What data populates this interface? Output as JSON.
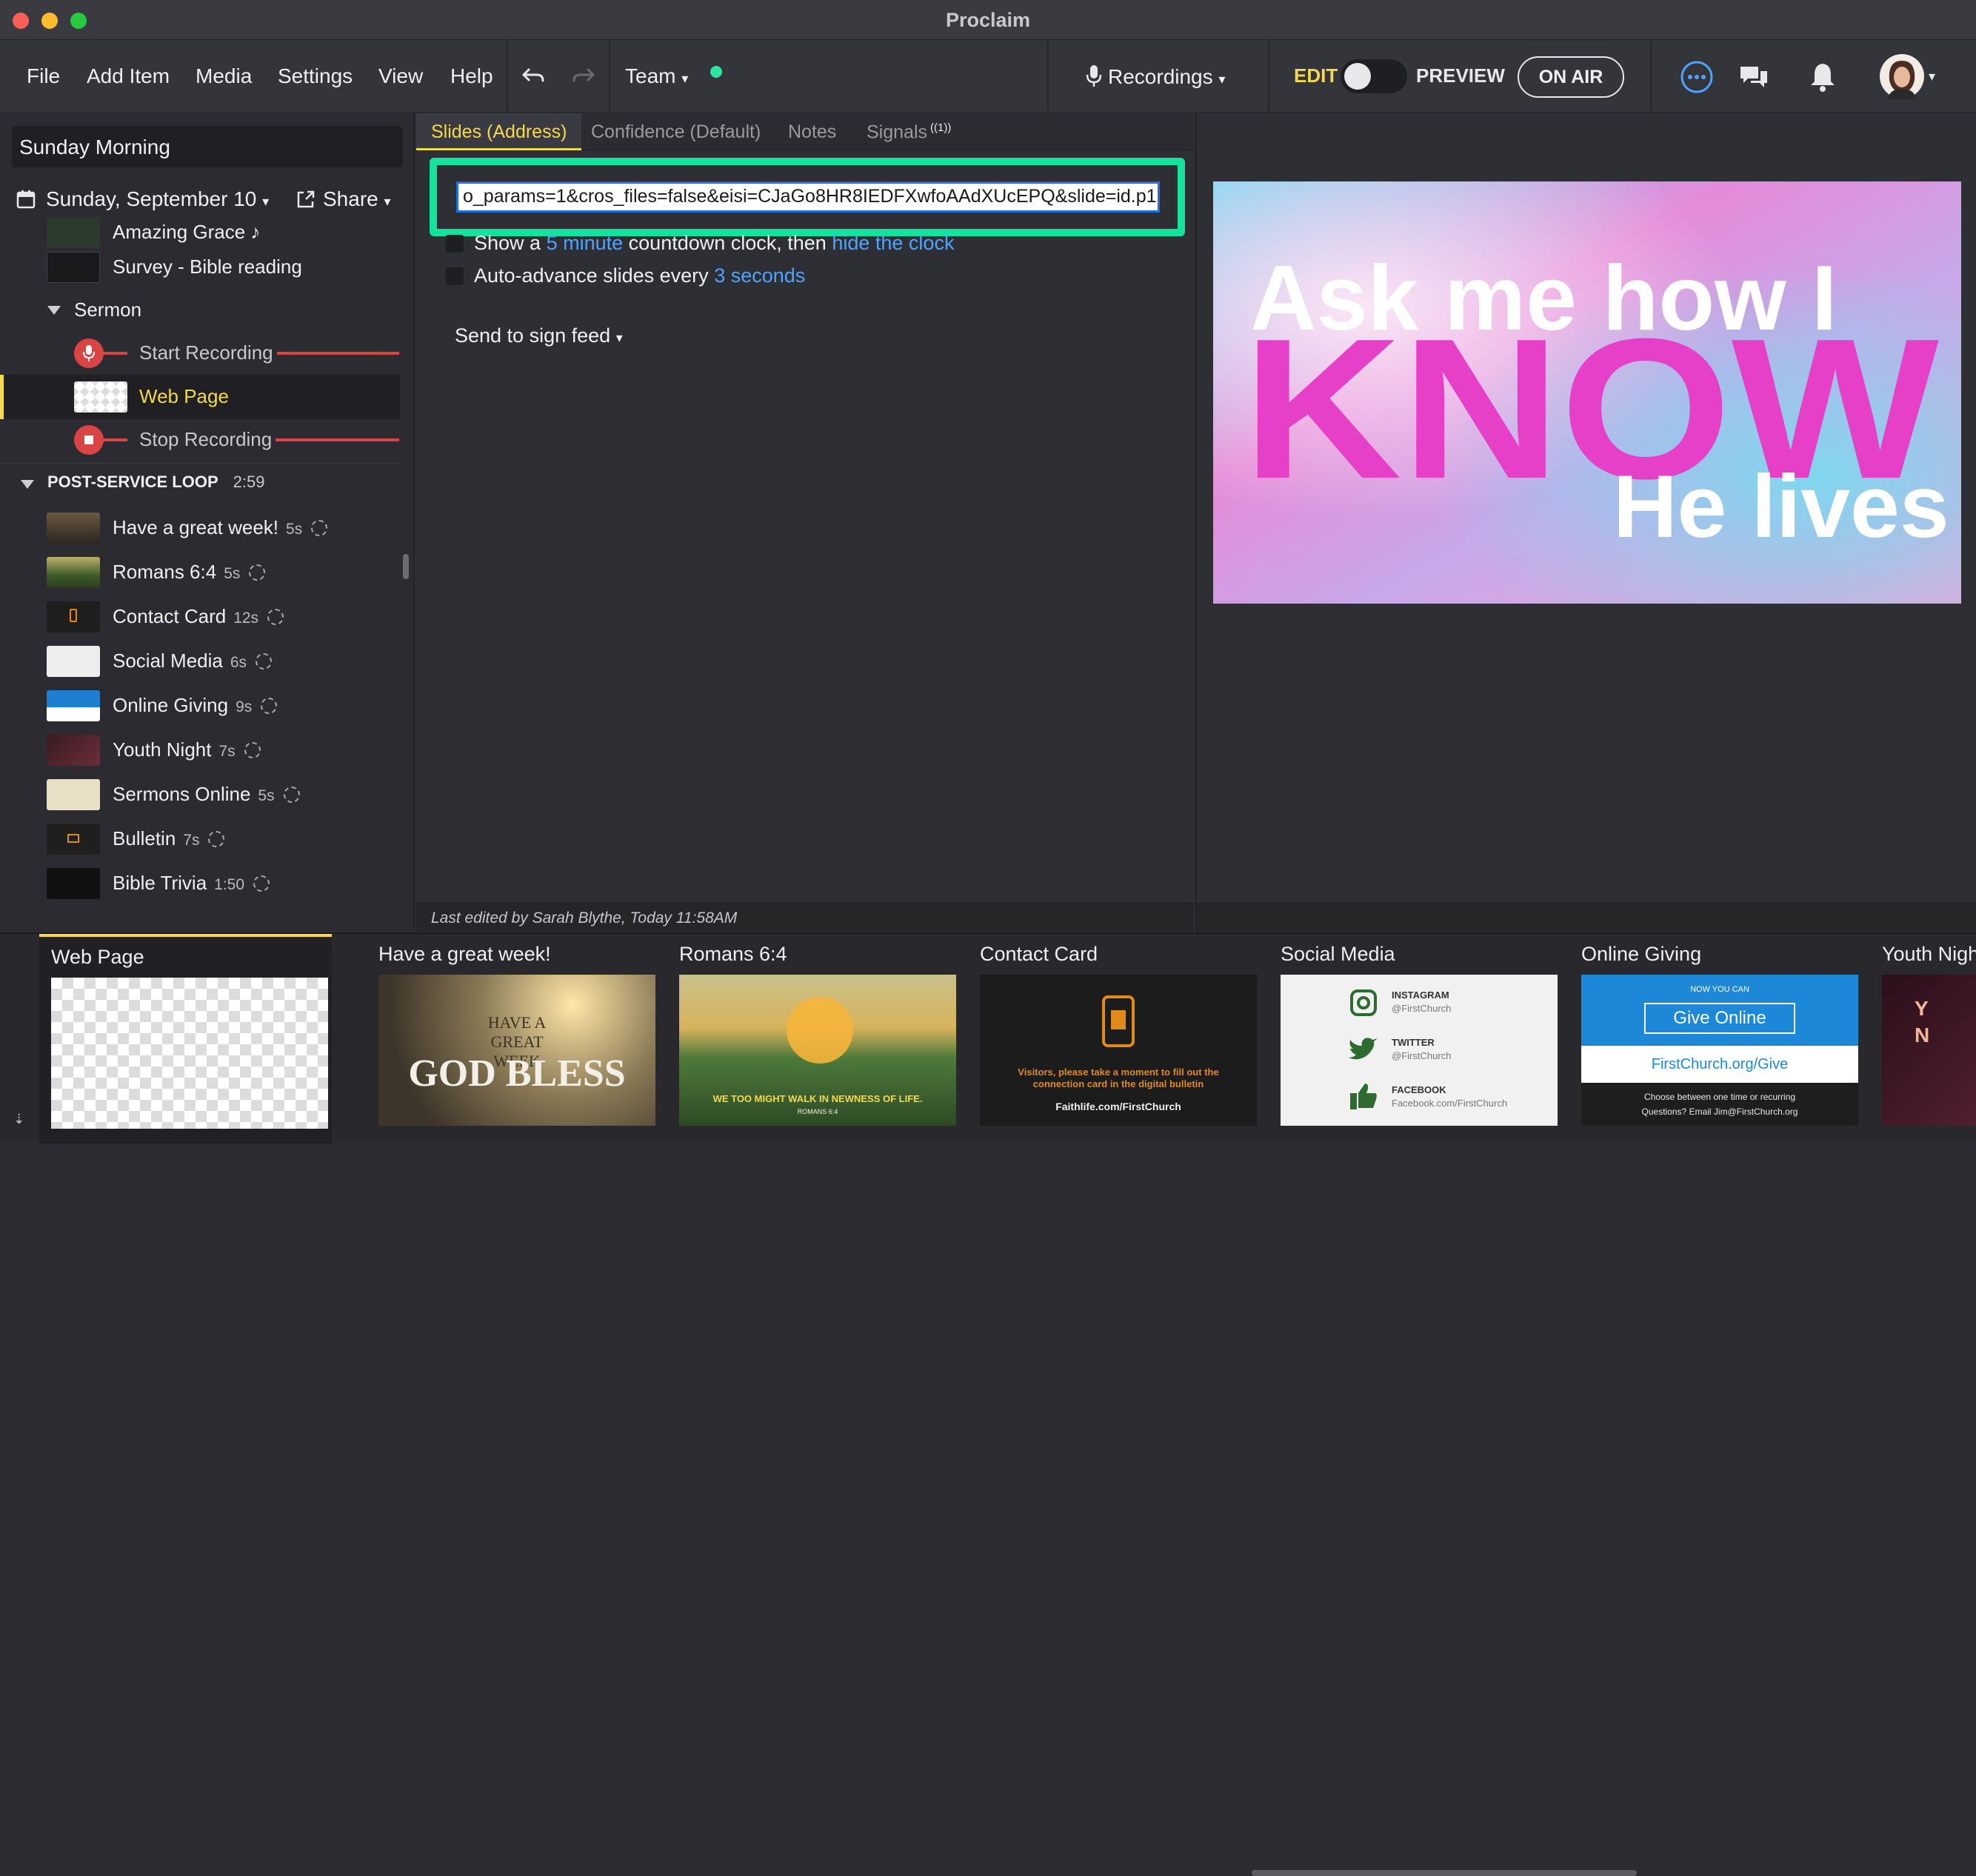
{
  "window": {
    "title": "Proclaim"
  },
  "menu": {
    "file": "File",
    "add_item": "Add Item",
    "media": "Media",
    "settings": "Settings",
    "view": "View",
    "help": "Help",
    "team": "Team",
    "recordings": "Recordings",
    "edit": "EDIT",
    "preview": "PREVIEW",
    "on_air": "ON AIR"
  },
  "sidebar": {
    "plan_name": "Sunday Morning",
    "date": "Sunday, September 10",
    "share": "Share",
    "items": [
      {
        "label": "Amazing Grace",
        "suffix": "♪"
      },
      {
        "label": "Survey - Bible reading"
      },
      {
        "label": "Sermon"
      },
      {
        "label": "Start Recording"
      },
      {
        "label": "Web Page"
      },
      {
        "label": "Stop Recording"
      }
    ],
    "loop_section": {
      "label": "POST-SERVICE LOOP",
      "duration": "2:59"
    },
    "loop_items": [
      {
        "label": "Have a great week!",
        "duration": "5s"
      },
      {
        "label": "Romans 6:4",
        "duration": "5s"
      },
      {
        "label": "Contact Card",
        "duration": "12s"
      },
      {
        "label": "Social Media",
        "duration": "6s"
      },
      {
        "label": "Online Giving",
        "duration": "9s"
      },
      {
        "label": "Youth Night",
        "duration": "7s"
      },
      {
        "label": "Sermons Online",
        "duration": "5s"
      },
      {
        "label": "Bulletin",
        "duration": "7s"
      },
      {
        "label": "Bible Trivia",
        "duration": "1:50"
      }
    ]
  },
  "center": {
    "tabs": {
      "slides": "Slides (Address)",
      "confidence": "Confidence (Default)",
      "notes": "Notes",
      "signals": "Signals",
      "signals_badge": "((1))"
    },
    "address_value": "o_params=1&cros_files=false&eisi=CJaGo8HR8IEDFXwfoAAdXUcEPQ&slide=id.p1",
    "countdown": {
      "pre": "Show a",
      "minutes_link": "5 minute",
      "mid": "countdown clock, then",
      "hide_link": "hide the clock"
    },
    "autoadvance": {
      "pre": "Auto-advance slides every",
      "seconds_link": "3 seconds"
    },
    "send_to_sign_feed": "Send to sign feed",
    "last_edited": "Last edited by Sarah Blythe, Today 11:58AM"
  },
  "preview": {
    "line1": "Ask me how I",
    "line2": "KNOW",
    "line3": "He lives"
  },
  "filmstrip": {
    "items": [
      {
        "label": "Web Page"
      },
      {
        "label": "Have a great week!",
        "thumb_small": "HAVE A GREAT WEEK",
        "thumb_big": "GOD BLESS"
      },
      {
        "label": "Romans 6:4",
        "thumb_text": "WE TOO MIGHT WALK IN NEWNESS OF LIFE.",
        "thumb_ref": "ROMANS 6:4"
      },
      {
        "label": "Contact Card",
        "thumb_text": "Visitors, please take a moment to fill out the connection card in the digital bulletin",
        "thumb_url": "Faithlife.com/FirstChurch"
      },
      {
        "label": "Social Media",
        "instagram": "INSTAGRAM",
        "instagram_handle": "@FirstChurch",
        "twitter": "TWITTER",
        "twitter_handle": "@FirstChurch",
        "facebook": "FACEBOOK",
        "facebook_handle": "Facebook.com/FirstChurch"
      },
      {
        "label": "Online Giving",
        "now_you_can": "NOW YOU CAN",
        "give_online": "Give Online",
        "url": "FirstChurch.org/Give",
        "note1": "Choose between one time or recurring",
        "note2": "Questions? Email Jim@FirstChurch.org"
      },
      {
        "label": "Youth Nigh"
      }
    ]
  },
  "colors": {
    "accent_yellow": "#f5d94a",
    "focus_green": "#15e29c",
    "link_blue": "#4fa3ff",
    "record_red": "#d94545"
  }
}
